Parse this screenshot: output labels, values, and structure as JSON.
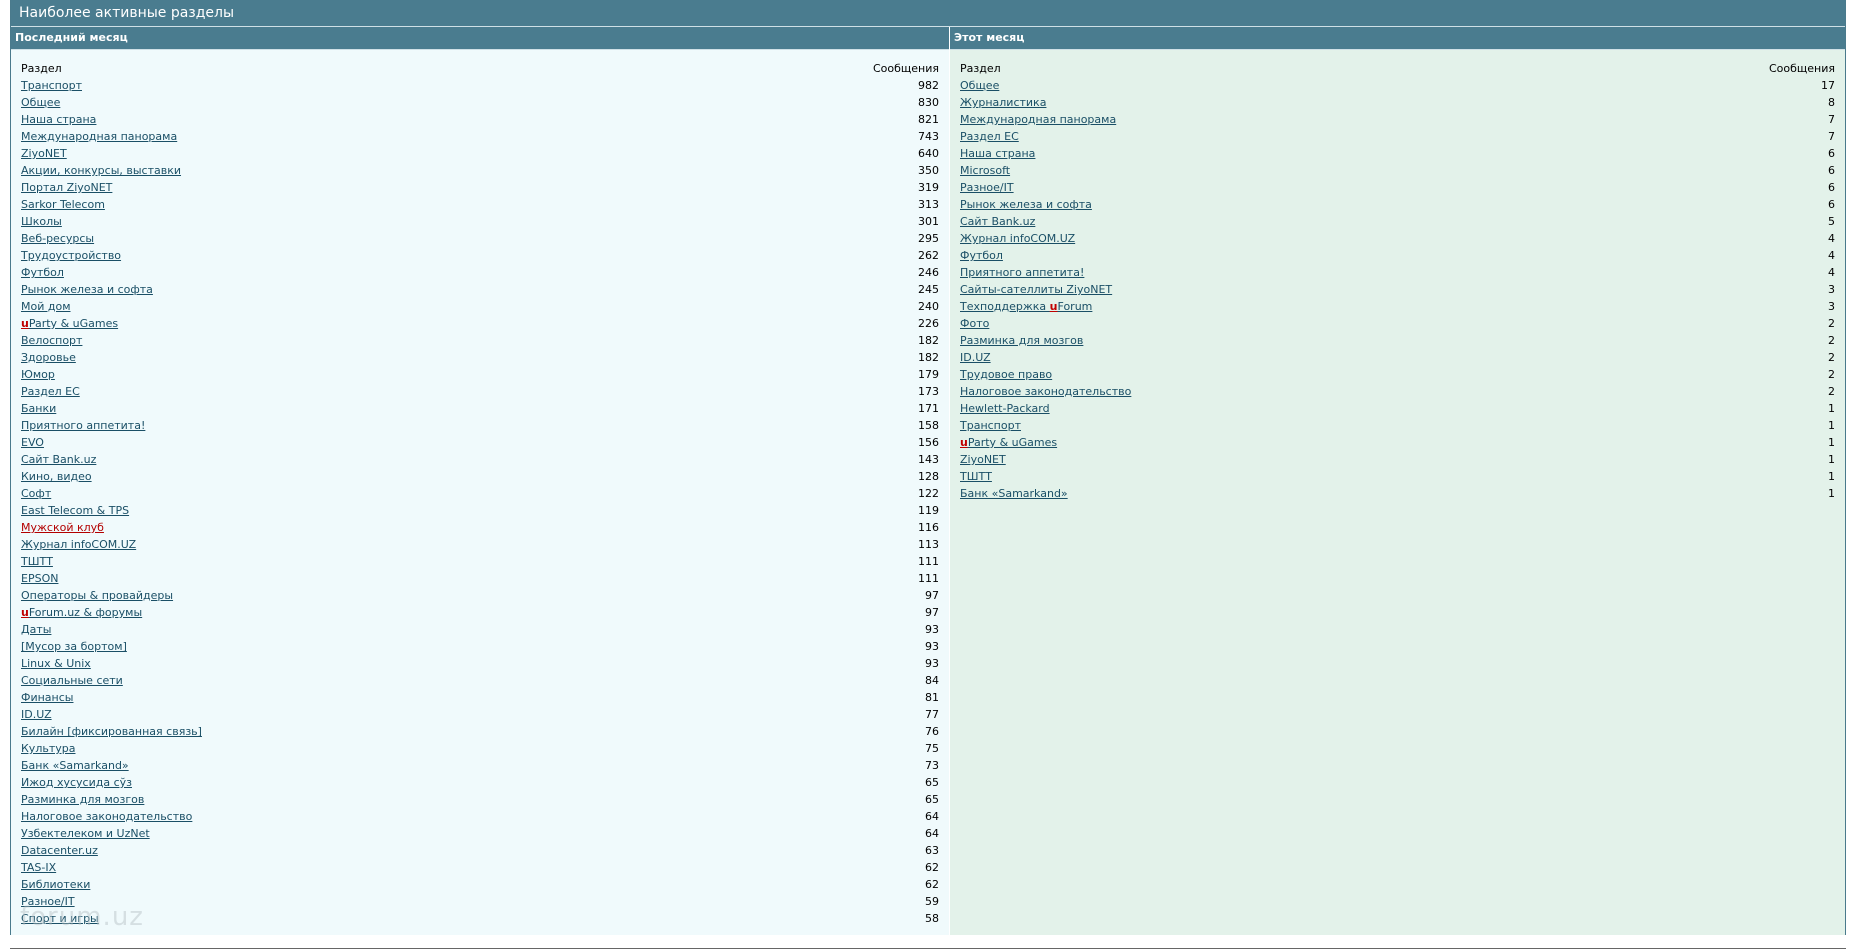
{
  "header": {
    "title": "Наиболее активные разделы"
  },
  "last_month": {
    "title": "Последний месяц",
    "col_section": "Раздел",
    "col_messages": "Сообщения",
    "rows": [
      {
        "prefix": "",
        "label": "Транспорт",
        "count": "982"
      },
      {
        "prefix": "",
        "label": "Общее",
        "count": "830"
      },
      {
        "prefix": "",
        "label": "Наша страна",
        "count": "821"
      },
      {
        "prefix": "",
        "label": "Международная панорама",
        "count": "743"
      },
      {
        "prefix": "",
        "label": "ZiyoNET",
        "count": "640"
      },
      {
        "prefix": "",
        "label": "Акции, конкурсы, выставки",
        "count": "350"
      },
      {
        "prefix": "",
        "label": "Портал ZiyoNET",
        "count": "319"
      },
      {
        "prefix": "",
        "label": "Sarkor Telecom",
        "count": "313"
      },
      {
        "prefix": "",
        "label": "Школы",
        "count": "301"
      },
      {
        "prefix": "",
        "label": "Веб-ресурсы",
        "count": "295"
      },
      {
        "prefix": "",
        "label": "Трудоустройство",
        "count": "262"
      },
      {
        "prefix": "",
        "label": "Футбол",
        "count": "246"
      },
      {
        "prefix": "",
        "label": "Рынок железа и софта",
        "count": "245"
      },
      {
        "prefix": "",
        "label": "Мой дом",
        "count": "240"
      },
      {
        "prefix": "u",
        "label": "Party & uGames",
        "count": "226"
      },
      {
        "prefix": "",
        "label": "Велоспорт",
        "count": "182"
      },
      {
        "prefix": "",
        "label": "Здоровье",
        "count": "182"
      },
      {
        "prefix": "",
        "label": "Юмор",
        "count": "179"
      },
      {
        "prefix": "",
        "label": "Раздел ЕС",
        "count": "173"
      },
      {
        "prefix": "",
        "label": "Банки",
        "count": "171"
      },
      {
        "prefix": "",
        "label": "Приятного аппетита!",
        "count": "158"
      },
      {
        "prefix": "",
        "label": "EVO",
        "count": "156"
      },
      {
        "prefix": "",
        "label": "Сайт Bank.uz",
        "count": "143"
      },
      {
        "prefix": "",
        "label": "Кино, видео",
        "count": "128"
      },
      {
        "prefix": "",
        "label": "Софт",
        "count": "122"
      },
      {
        "prefix": "",
        "label": "East Telecom & TPS",
        "count": "119"
      },
      {
        "prefix": "",
        "label": "Мужской клуб",
        "count": "116",
        "red": true
      },
      {
        "prefix": "",
        "label": "Журнал infoCOM.UZ",
        "count": "113"
      },
      {
        "prefix": "",
        "label": "ТШТТ",
        "count": "111"
      },
      {
        "prefix": "",
        "label": "EPSON",
        "count": "111"
      },
      {
        "prefix": "",
        "label": "Операторы & провайдеры",
        "count": "97"
      },
      {
        "prefix": "u",
        "label": "Forum.uz & форумы",
        "count": "97"
      },
      {
        "prefix": "",
        "label": "Даты",
        "count": "93"
      },
      {
        "prefix": "",
        "label": "[Мусор за бортом]",
        "count": "93"
      },
      {
        "prefix": "",
        "label": "Linux & Unix",
        "count": "93"
      },
      {
        "prefix": "",
        "label": "Социальные сети",
        "count": "84"
      },
      {
        "prefix": "",
        "label": "Финансы",
        "count": "81"
      },
      {
        "prefix": "",
        "label": "ID.UZ",
        "count": "77"
      },
      {
        "prefix": "",
        "label": "Билайн [фиксированная связь]",
        "count": "76"
      },
      {
        "prefix": "",
        "label": "Культура",
        "count": "75"
      },
      {
        "prefix": "",
        "label": "Банк «Samarkand»",
        "count": "73"
      },
      {
        "prefix": "",
        "label": "Ижод хусусида сўз",
        "count": "65"
      },
      {
        "prefix": "",
        "label": "Разминка для мозгов",
        "count": "65"
      },
      {
        "prefix": "",
        "label": "Налоговое законодательство",
        "count": "64"
      },
      {
        "prefix": "",
        "label": "Узбектелеком и UzNet",
        "count": "64"
      },
      {
        "prefix": "",
        "label": "Datacenter.uz",
        "count": "63"
      },
      {
        "prefix": "",
        "label": "TAS-IX",
        "count": "62"
      },
      {
        "prefix": "",
        "label": "Библиотеки",
        "count": "62"
      },
      {
        "prefix": "",
        "label": "Разное/IT",
        "count": "59"
      },
      {
        "prefix": "",
        "label": "Спорт и игры",
        "count": "58"
      }
    ]
  },
  "this_month": {
    "title": "Этот месяц",
    "col_section": "Раздел",
    "col_messages": "Сообщения",
    "rows": [
      {
        "prefix": "",
        "label": "Общее",
        "count": "17"
      },
      {
        "prefix": "",
        "label": "Журналистика",
        "count": "8"
      },
      {
        "prefix": "",
        "label": "Международная панорама",
        "count": "7"
      },
      {
        "prefix": "",
        "label": "Раздел ЕС",
        "count": "7"
      },
      {
        "prefix": "",
        "label": "Наша страна",
        "count": "6"
      },
      {
        "prefix": "",
        "label": "Microsoft",
        "count": "6"
      },
      {
        "prefix": "",
        "label": "Разное/IT",
        "count": "6"
      },
      {
        "prefix": "",
        "label": "Рынок железа и софта",
        "count": "6"
      },
      {
        "prefix": "",
        "label": "Сайт Bank.uz",
        "count": "5"
      },
      {
        "prefix": "",
        "label": "Журнал infoCOM.UZ",
        "count": "4"
      },
      {
        "prefix": "",
        "label": "Футбол",
        "count": "4"
      },
      {
        "prefix": "",
        "label": "Приятного аппетита!",
        "count": "4"
      },
      {
        "prefix": "",
        "label": "Сайты-сателлиты ZiyoNET",
        "count": "3"
      },
      {
        "prefix": "",
        "label": "Техподдержка ",
        "u_mid": "u",
        "suffix": "Forum",
        "count": "3"
      },
      {
        "prefix": "",
        "label": "Фото",
        "count": "2"
      },
      {
        "prefix": "",
        "label": "Разминка для мозгов",
        "count": "2"
      },
      {
        "prefix": "",
        "label": "ID.UZ",
        "count": "2"
      },
      {
        "prefix": "",
        "label": "Трудовое право",
        "count": "2"
      },
      {
        "prefix": "",
        "label": "Налоговое законодательство",
        "count": "2"
      },
      {
        "prefix": "",
        "label": "Hewlett-Packard",
        "count": "1"
      },
      {
        "prefix": "",
        "label": "Транспорт",
        "count": "1"
      },
      {
        "prefix": "u",
        "label": "Party & uGames",
        "count": "1"
      },
      {
        "prefix": "",
        "label": "ZiyoNET",
        "count": "1"
      },
      {
        "prefix": "",
        "label": "ТШТТ",
        "count": "1"
      },
      {
        "prefix": "",
        "label": "Банк «Samarkand»",
        "count": "1"
      }
    ]
  },
  "watermark": "forum.uz"
}
